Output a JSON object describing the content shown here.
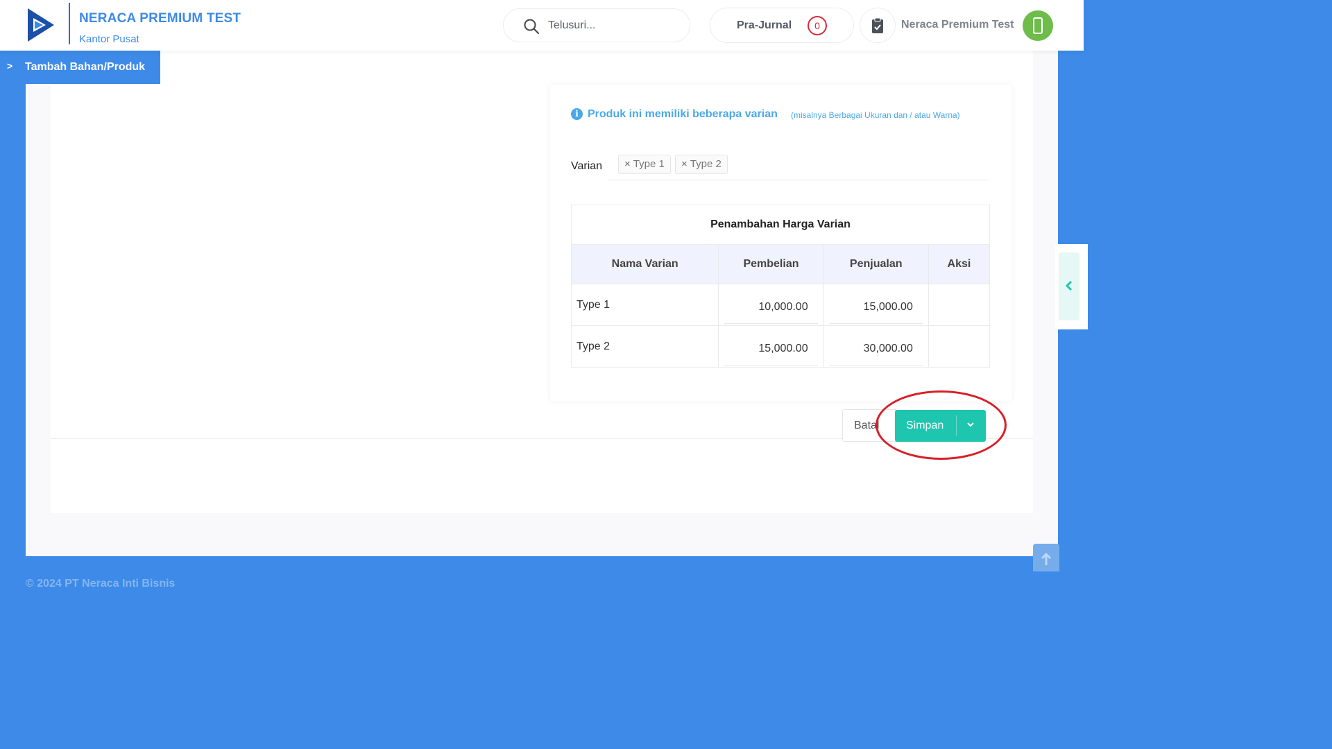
{
  "brand": {
    "title": "NERACA PREMIUM TEST",
    "subtitle": "Kantor Pusat",
    "logo_icon": "play-triangle-logo-icon"
  },
  "search": {
    "placeholder": "Telusuri...",
    "value": "",
    "icon": "search-icon"
  },
  "prajurnal": {
    "label": "Pra-Jurnal",
    "count": "0"
  },
  "user": {
    "clipboard_icon": "clipboard-check-icon",
    "name": "Neraca Premium Test",
    "avatar_icon": "phone-icon",
    "avatar_color": "#6ebd4a"
  },
  "breadcrumb": {
    "chevron": ">",
    "label": "Tambah Bahan/Produk"
  },
  "variants": {
    "heading": "Produk ini memiliki beberapa varian",
    "hint": "(misalnya Berbagai Ukuran dan / atau Warna)",
    "label": "Varian",
    "tags": [
      {
        "remove": "×",
        "label": "Type 1"
      },
      {
        "remove": "×",
        "label": "Type 2"
      }
    ],
    "table": {
      "title": "Penambahan Harga Varian",
      "columns": [
        "Nama Varian",
        "Pembelian",
        "Penjualan",
        "Aksi"
      ],
      "rows": [
        {
          "name": "Type 1",
          "purchase": "10,000.00",
          "sale": "15,000.00",
          "action": ""
        },
        {
          "name": "Type 2",
          "purchase": "15,000.00",
          "sale": "30,000.00",
          "action": ""
        }
      ]
    }
  },
  "actions": {
    "cancel_label": "Batal",
    "save_label": "Simpan",
    "save_caret": "⌄"
  },
  "colors": {
    "primary_blue": "#3d8ae8",
    "teal": "#1ec6b0",
    "highlight_red": "#d81f27"
  },
  "footer": {
    "copyright": "© 2024 PT Neraca Inti Bisnis"
  }
}
